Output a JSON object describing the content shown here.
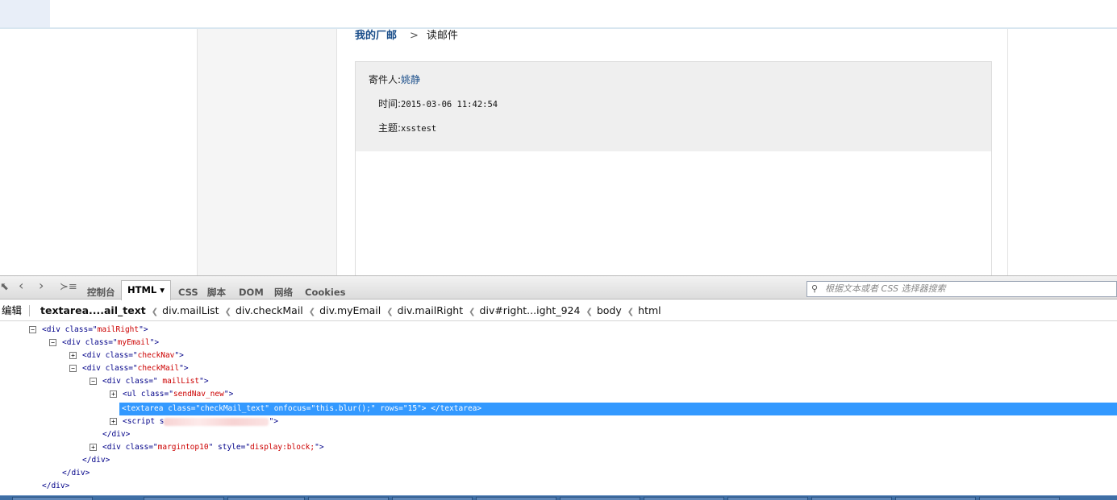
{
  "page": {
    "breadcrumb": {
      "home": "我的厂邮",
      "separator": ">",
      "current": "读邮件"
    },
    "mail": {
      "sender_label": "寄件人:",
      "sender": "姚静",
      "time_label": "时间:",
      "time": "2015-03-06 11:42:54",
      "subject_label": "主题:",
      "subject": "xsstest"
    }
  },
  "firebug": {
    "tabs": [
      {
        "label": "控制台"
      },
      {
        "label": "HTML ▾"
      },
      {
        "label": "CSS"
      },
      {
        "label": "脚本"
      },
      {
        "label": "DOM"
      },
      {
        "label": "网络"
      },
      {
        "label": "Cookies"
      }
    ],
    "active_tab": "HTML",
    "search_placeholder": "根据文本或者 CSS 选择器搜索",
    "edit_label": "编辑",
    "crumbs": [
      "textarea....ail_text",
      "div.mailList",
      "div.checkMail",
      "div.myEmail",
      "div.mailRight",
      "div#right...ight_924",
      "body",
      "html"
    ],
    "tree": [
      {
        "toggle": "−",
        "open": "<div class=\"",
        "attr_value": "mailRight",
        "close": "\">"
      },
      {
        "toggle": "−",
        "open": "<div class=\"",
        "attr_value": "myEmail",
        "close": "\">"
      },
      {
        "toggle": "+",
        "open": "<div class=\"",
        "attr_value": "checkNav",
        "close": "\">"
      },
      {
        "toggle": "−",
        "open": "<div class=\"",
        "attr_value": "checkMail",
        "close": "\">"
      },
      {
        "toggle": "−",
        "open": "<div class=\"",
        "attr_value": " mailList",
        "close": "\">"
      },
      {
        "toggle": "+",
        "open": "<ul class=\"",
        "attr_value": "sendNav_new",
        "close": "\">"
      },
      {
        "text": "<textarea class=\"checkMail_text\" onfocus=\"this.blur();\" rows=\"15\">  </textarea>"
      },
      {
        "toggle": "+",
        "open": "<script s",
        "close": "\">"
      },
      {
        "text": "</div>"
      },
      {
        "toggle": "+",
        "open": "<div class=\"",
        "attr_value": "margintop10",
        "mid": "\" style=\"",
        "attr_value2": "display:block;",
        "close": "\">"
      },
      {
        "text": "</div>"
      },
      {
        "text": "</div>"
      },
      {
        "text": "</div>"
      }
    ]
  },
  "colors": {
    "selection": "#3399ff",
    "tag": "#000088",
    "attr_value": "#cc0000",
    "link": "#1a4e8a"
  }
}
